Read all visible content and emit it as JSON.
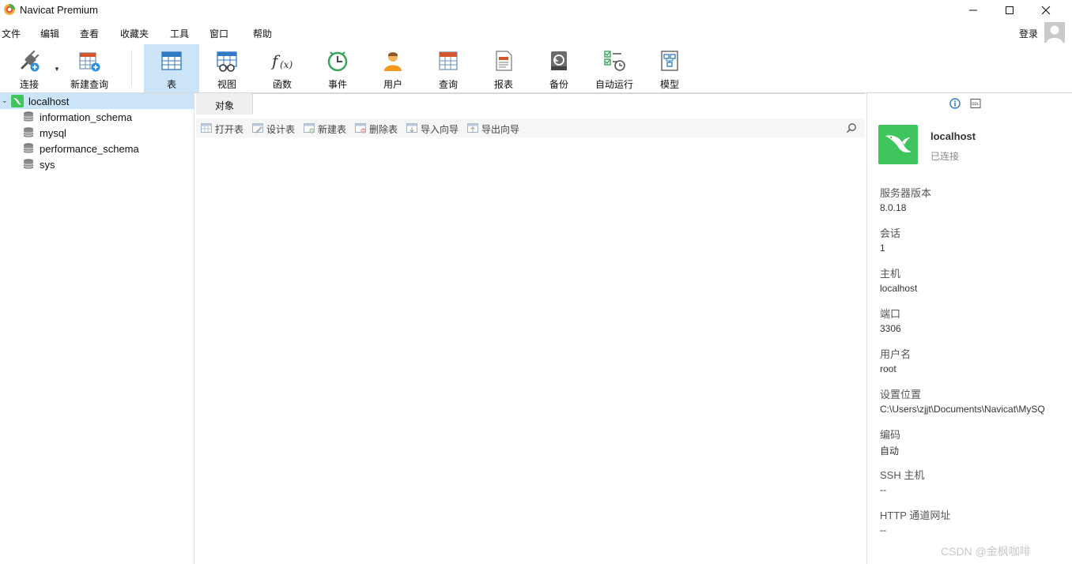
{
  "window": {
    "title": "Navicat Premium"
  },
  "menubar": {
    "items": [
      "文件",
      "编辑",
      "查看",
      "收藏夹",
      "工具",
      "窗口",
      "帮助"
    ],
    "login_label": "登录"
  },
  "toolbar": {
    "buttons": [
      {
        "label": "连接",
        "icon": "connect-plug-icon"
      },
      {
        "label": "新建查询",
        "icon": "new-query-icon"
      },
      {
        "label": "表",
        "icon": "table-icon",
        "active": true
      },
      {
        "label": "视图",
        "icon": "view-icon"
      },
      {
        "label": "函数",
        "icon": "function-icon"
      },
      {
        "label": "事件",
        "icon": "event-clock-icon"
      },
      {
        "label": "用户",
        "icon": "user-icon"
      },
      {
        "label": "查询",
        "icon": "query-icon"
      },
      {
        "label": "报表",
        "icon": "report-icon"
      },
      {
        "label": "备份",
        "icon": "backup-icon"
      },
      {
        "label": "自动运行",
        "icon": "automation-icon"
      },
      {
        "label": "模型",
        "icon": "model-icon"
      }
    ]
  },
  "tree": {
    "connection": "localhost",
    "databases": [
      "information_schema",
      "mysql",
      "performance_schema",
      "sys"
    ]
  },
  "objects": {
    "tab_label": "对象",
    "actions": [
      "打开表",
      "设计表",
      "新建表",
      "删除表",
      "导入向导",
      "导出向导"
    ]
  },
  "info": {
    "name": "localhost",
    "status": "已连接",
    "rows": [
      {
        "label": "服务器版本",
        "value": "8.0.18"
      },
      {
        "label": "会话",
        "value": "1"
      },
      {
        "label": "主机",
        "value": "localhost"
      },
      {
        "label": "端口",
        "value": "3306"
      },
      {
        "label": "用户名",
        "value": "root"
      },
      {
        "label": "设置位置",
        "value": "C:\\Users\\zjjt\\Documents\\Navicat\\MySQ"
      },
      {
        "label": "编码",
        "value": "自动"
      },
      {
        "label": "SSH 主机",
        "value": "--"
      },
      {
        "label": "HTTP 通道网址",
        "value": "--"
      }
    ]
  },
  "watermark": "CSDN @金枫咖啡"
}
